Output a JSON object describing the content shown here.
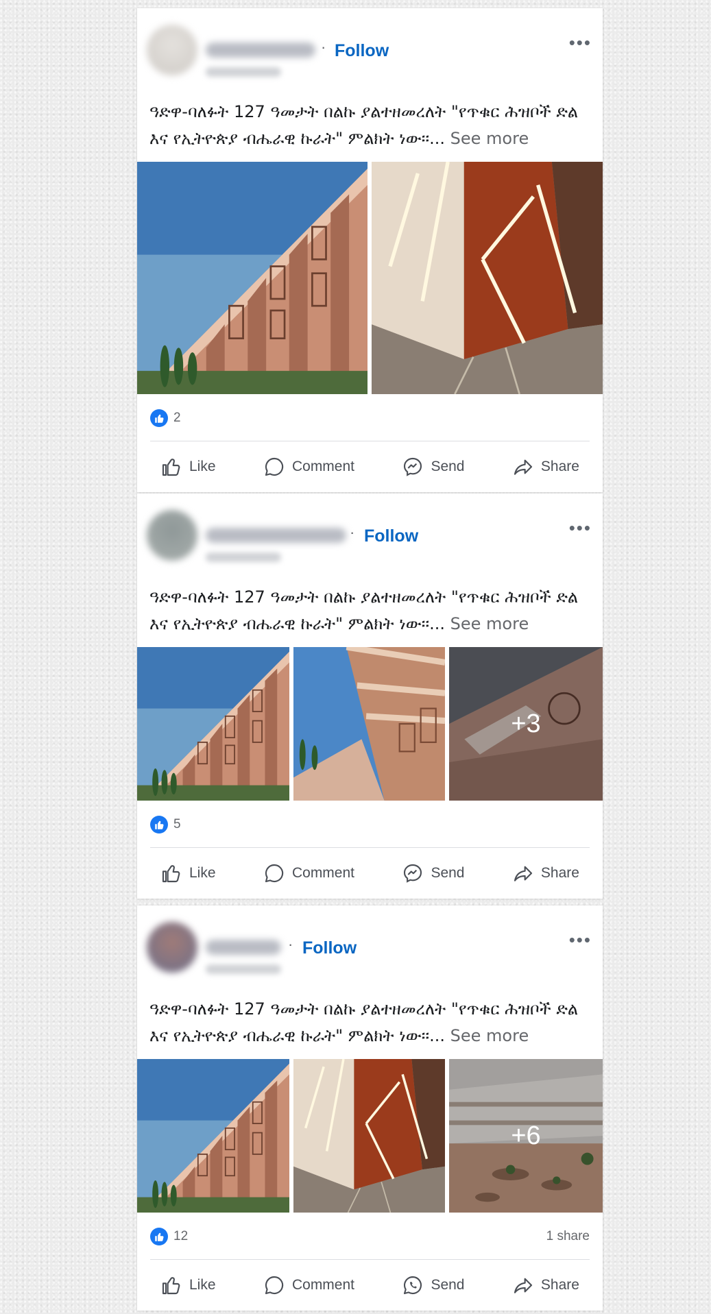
{
  "posts": [
    {
      "follow_label": "Follow",
      "more_label": "•••",
      "text": "ዓድዋ-ባለፉት 127 ዓመታት በልኩ ያልተዘመረለት \"የጥቁር ሕዝቦች ድል እና የኢትዮጵያ ብሔራዊ ኩራት\" ምልክት ነው፡፡...",
      "see_more": "See more",
      "likes": "2",
      "shares": "",
      "actions": {
        "like": "Like",
        "comment": "Comment",
        "send": "Send",
        "share": "Share"
      }
    },
    {
      "follow_label": "Follow",
      "more_label": "•••",
      "text": "ዓድዋ-ባለፉት 127 ዓመታት በልኩ ያልተዘመረለት \"የጥቁር ሕዝቦች ድል እና የኢትዮጵያ ብሔራዊ ኩራት\" ምልክት ነው፡፡...",
      "see_more": "See more",
      "more_photos": "+3",
      "likes": "5",
      "shares": "",
      "actions": {
        "like": "Like",
        "comment": "Comment",
        "send": "Send",
        "share": "Share"
      }
    },
    {
      "follow_label": "Follow",
      "more_label": "•••",
      "text": "ዓድዋ-ባለፉት 127 ዓመታት በልኩ ያልተዘመረለት \"የጥቁር ሕዝቦች ድል እና የኢትዮጵያ ብሔራዊ ኩራት\" ምልክት ነው፡፡...",
      "see_more": "See more",
      "more_photos": "+6",
      "likes": "12",
      "shares": "1 share",
      "actions": {
        "like": "Like",
        "comment": "Comment",
        "send": "Send",
        "share": "Share"
      }
    }
  ],
  "icons": {
    "like": "thumbs-up-outline",
    "comment": "speech-bubble-outline",
    "send": "messenger-outline",
    "send_alt": "whatsapp-outline",
    "share": "share-arrow-outline",
    "reaction": "like-reaction-badge"
  },
  "colors": {
    "follow": "#0a66c2",
    "reaction": "#1877f2",
    "text": "#1c1e21",
    "muted": "#65676b"
  }
}
